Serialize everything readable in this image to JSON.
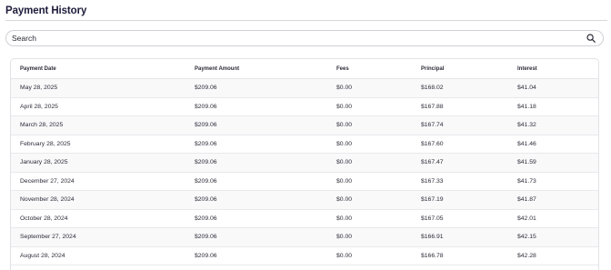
{
  "header": {
    "title": "Payment History"
  },
  "search": {
    "placeholder": "Search",
    "icon": "search-icon"
  },
  "table": {
    "columns": [
      "Payment Date",
      "Payment Amount",
      "Fees",
      "Principal",
      "Interest"
    ],
    "rows": [
      [
        "May 28, 2025",
        "$209.06",
        "$0.00",
        "$168.02",
        "$41.04"
      ],
      [
        "April 28, 2025",
        "$209.06",
        "$0.00",
        "$167.88",
        "$41.18"
      ],
      [
        "March 28, 2025",
        "$209.06",
        "$0.00",
        "$167.74",
        "$41.32"
      ],
      [
        "February 28, 2025",
        "$209.06",
        "$0.00",
        "$167.60",
        "$41.46"
      ],
      [
        "January 28, 2025",
        "$209.06",
        "$0.00",
        "$167.47",
        "$41.59"
      ],
      [
        "December 27, 2024",
        "$209.06",
        "$0.00",
        "$167.33",
        "$41.73"
      ],
      [
        "November 28, 2024",
        "$209.06",
        "$0.00",
        "$167.19",
        "$41.87"
      ],
      [
        "October 28, 2024",
        "$209.06",
        "$0.00",
        "$167.05",
        "$42.01"
      ],
      [
        "September 27, 2024",
        "$209.06",
        "$0.00",
        "$166.91",
        "$42.15"
      ],
      [
        "August 28, 2024",
        "$209.06",
        "$0.00",
        "$166.78",
        "$42.28"
      ]
    ]
  }
}
